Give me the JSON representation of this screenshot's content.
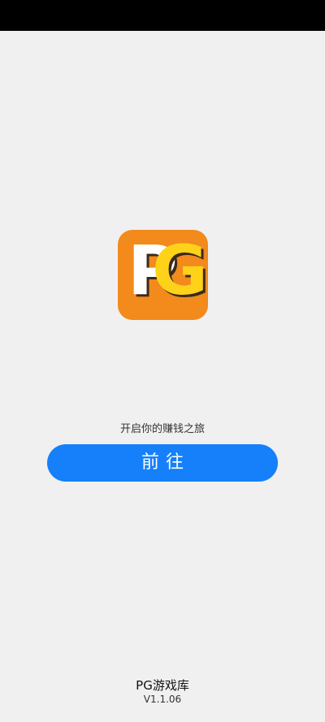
{
  "logo": {
    "letter_p": "P",
    "letter_g": "G",
    "background_color": "#f28a1c",
    "p_color": "#ffffff",
    "g_color": "#ffd21a"
  },
  "tagline": "开启你的赚钱之旅",
  "go_button": {
    "label": "前往",
    "color": "#1580f9"
  },
  "footer": {
    "app_name": "PG游戏库",
    "version": "V1.1.06"
  }
}
